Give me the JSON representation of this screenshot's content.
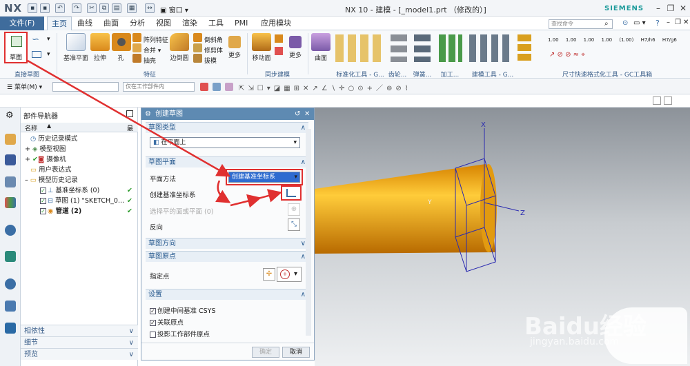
{
  "titlebar": {
    "logo": "NX",
    "title": "NX 10 - 建模 - [_model1.prt （修改的）]",
    "brand": "SIEMENS",
    "window_menu": "窗口"
  },
  "menu_tabs": {
    "file": "文件(F)",
    "tabs": [
      "主页",
      "曲线",
      "曲面",
      "分析",
      "视图",
      "渲染",
      "工具",
      "PMI",
      "应用模块"
    ],
    "active": "主页"
  },
  "search": {
    "placeholder": "查找命令"
  },
  "ribbon": {
    "sketch": "草图",
    "direct_sketch_group": "直接草图",
    "feature_buttons": [
      "基准平面",
      "拉伸",
      "孔"
    ],
    "feature_small": [
      "阵列特征",
      "合并",
      "抽壳"
    ],
    "edge_blend": "边倒圆",
    "edge_small": [
      "倒斜角",
      "修剪体",
      "拔模"
    ],
    "more": "更多",
    "feature_group": "特征",
    "move_face": "移动面",
    "sync_group": "同步建模",
    "surface": "曲面",
    "standardization_group": "标准化工具 - G...",
    "gear_group": "齿轮...",
    "spring_group": "弹簧...",
    "machining_group": "加工...",
    "modeling_tools_group": "建模工具 - G...",
    "dimension_group": "尺寸快速格式化工具 - GC工具箱",
    "dim_values": [
      "1.00",
      "1.00",
      "1.00",
      "1.00",
      "(1.00)",
      "H7/h6",
      "H7/g6"
    ]
  },
  "toolbar2": {
    "menu": "菜单(M)",
    "filter_placeholder": "",
    "scope": "仅在工作部件内"
  },
  "navigator": {
    "title": "部件导航器",
    "col_name": "名称",
    "col_latest": "最",
    "items": [
      {
        "label": "历史记录模式",
        "indent": 0
      },
      {
        "label": "模型视图",
        "indent": 0
      },
      {
        "label": "摄像机",
        "indent": 0
      },
      {
        "label": "用户表达式",
        "indent": 0
      },
      {
        "label": "模型历史记录",
        "indent": 0
      },
      {
        "label": "基准坐标系 (0)",
        "indent": 1
      },
      {
        "label": "草图 (1) \"SKETCH_0...",
        "indent": 1
      },
      {
        "label": "管道 (2)",
        "indent": 1
      }
    ],
    "panels": [
      "相依性",
      "细节",
      "预览"
    ]
  },
  "dialog": {
    "title": "创建草图",
    "sec_type": "草图类型",
    "type_value": "在平面上",
    "sec_plane": "草图平面",
    "plane_method_label": "平面方法",
    "plane_method_value": "创建基准坐标系",
    "create_csys_label": "创建基准坐标系",
    "select_face_label": "选择平的面或平面 (0)",
    "reverse_label": "反向",
    "sec_direction": "草图方向",
    "sec_origin": "草图原点",
    "point_label": "指定点",
    "sec_settings": "设置",
    "settings": [
      {
        "label": "创建中间基准 CSYS",
        "checked": true
      },
      {
        "label": "关联原点",
        "checked": true
      },
      {
        "label": "投影工作部件原点",
        "checked": false
      }
    ],
    "ok": "确定",
    "cancel": "取消"
  },
  "viewport": {
    "axis_x": "X",
    "axis_y": "Y",
    "axis_z": "Z",
    "watermark_brand": "Baidu经验",
    "watermark_url": "jingyan.baidu.com"
  },
  "colors": {
    "accent_red": "#e03030",
    "cylinder": "#f5a800",
    "title_blue": "#5e8ab2",
    "file_tab": "#3f6c9c"
  }
}
